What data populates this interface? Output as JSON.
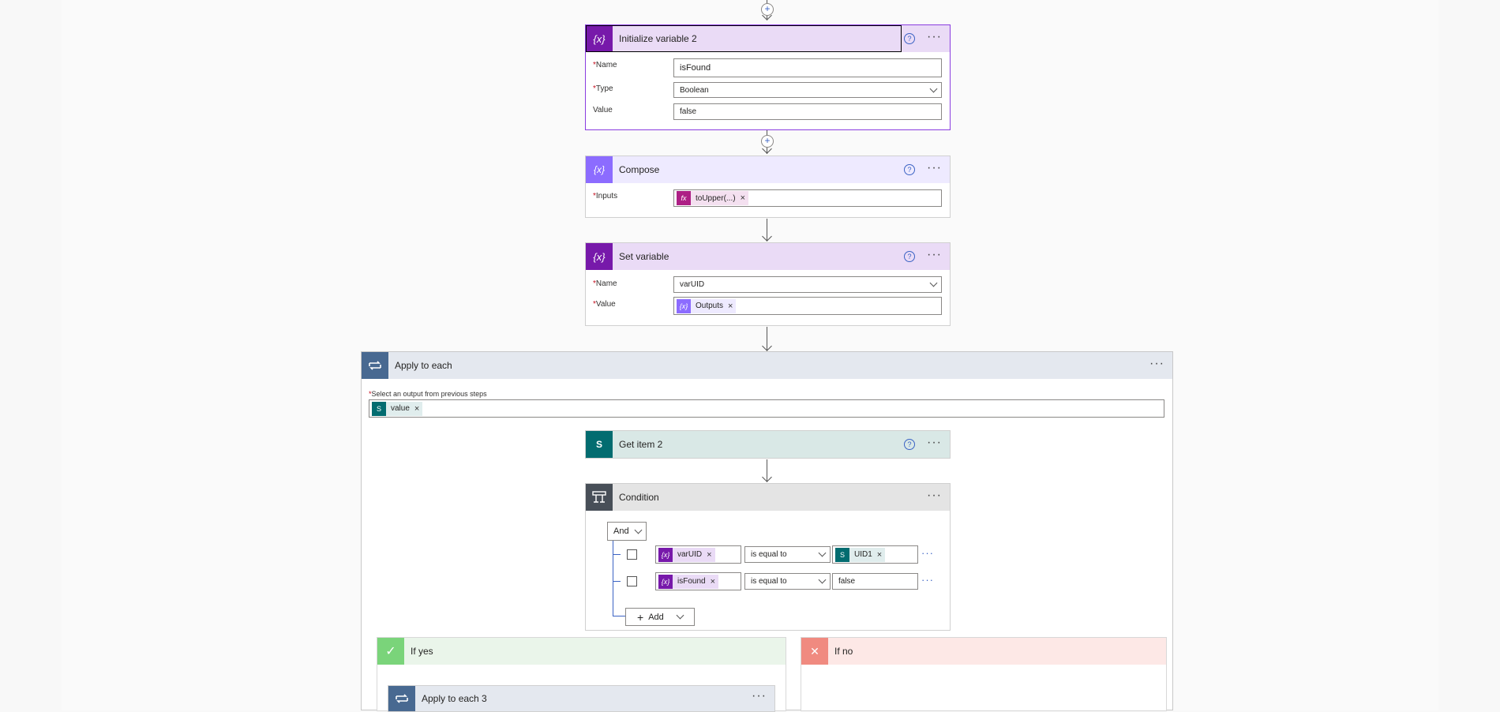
{
  "colors": {
    "variable_purple": "#7719aa",
    "compose_purple": "#8c6cff",
    "sharepoint_teal": "#036c70",
    "loop_slate": "#486991",
    "condition_gray": "#484f58",
    "yes_green": "#7ad47a",
    "no_red": "#f08a80"
  },
  "init_var": {
    "title": "Initialize variable 2",
    "name_label": "Name",
    "name_value": "isFound",
    "type_label": "Type",
    "type_value": "Boolean",
    "value_label": "Value",
    "value_value": "false",
    "icon": "variable-icon"
  },
  "compose": {
    "title": "Compose",
    "inputs_label": "Inputs",
    "token_label": "toUpper(...)",
    "token_icon": "fx-icon",
    "icon": "compose-icon"
  },
  "set_var": {
    "title": "Set variable",
    "name_label": "Name",
    "name_value": "varUID",
    "value_label": "Value",
    "token_label": "Outputs",
    "icon": "variable-icon"
  },
  "apply_each": {
    "title": "Apply to each",
    "select_label": "Select an output from previous steps",
    "token_label": "value",
    "icon": "loop-icon"
  },
  "get_item": {
    "title": "Get item 2",
    "icon": "sharepoint-icon"
  },
  "condition": {
    "title": "Condition",
    "operator": "And",
    "rows": [
      {
        "left_token": "varUID",
        "op": "is equal to",
        "right_token": "UID1",
        "right_is_token": true
      },
      {
        "left_token": "isFound",
        "op": "is equal to",
        "right_value": "false",
        "right_is_token": false
      }
    ],
    "add_label": "Add"
  },
  "if_yes": {
    "title": "If yes",
    "nested_title": "Apply to each 3"
  },
  "if_no": {
    "title": "If no"
  },
  "glyphs": {
    "help": "?",
    "more": "···",
    "remove": "×",
    "plus": "+",
    "check": "✓",
    "cross": "✕",
    "var": "{x}",
    "fx": "fx",
    "sp": "S"
  }
}
